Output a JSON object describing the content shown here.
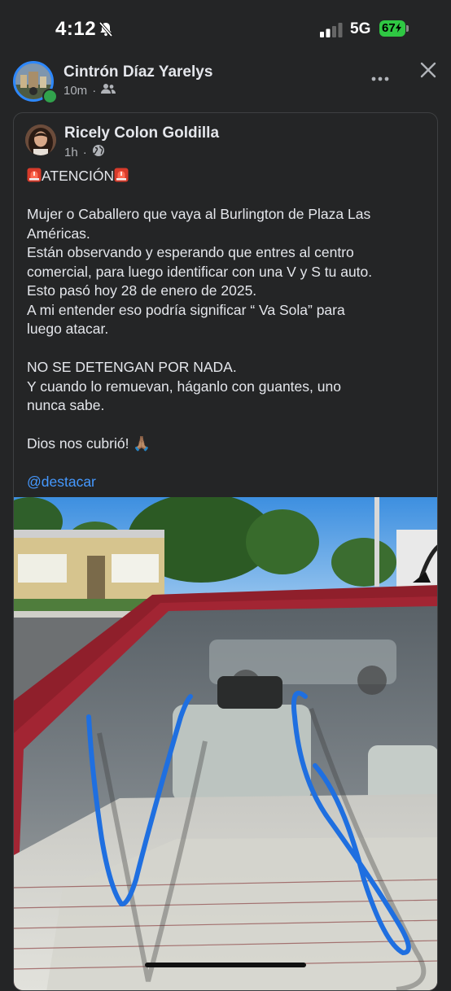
{
  "status_bar": {
    "time": "4:12",
    "network": "5G",
    "battery": "67"
  },
  "post": {
    "author": "Cintrón Díaz Yarelys",
    "time": "10m",
    "audience_icon": "friends-icon",
    "more_icon": "ellipsis-icon",
    "close_icon": "close-icon"
  },
  "shared_post": {
    "author": "Ricely Colon Goldilla",
    "time": "1h",
    "audience_icon": "globe-icon",
    "heading": "ATENCIÓN",
    "paragraph1": [
      "Mujer o Caballero que vaya al Burlington de Plaza Las",
      "Américas.",
      "Están observando y esperando que entres al centro",
      "comercial, para luego identificar con una V y S tu auto.",
      "Esto pasó hoy 28 de enero de 2025.",
      "A mi entender eso podría significar “ Va Sola” para",
      "luego atacar."
    ],
    "paragraph2": [
      "NO SE DETENGAN POR NADA.",
      "Y cuando lo remuevan, háganlo con guantes, uno",
      "nunca sabe."
    ],
    "closing": "Dios nos cubrió!",
    "closing_emoji": "🙏🏽",
    "hashtag": "@destacar"
  },
  "colors": {
    "background": "#242526",
    "text": "#e4e6eb",
    "secondary": "#b0b3b8",
    "link": "#4599ff",
    "battery": "#2fc743",
    "story_ring": "#2d88ff",
    "online": "#31a24c",
    "marker_blue": "#1f6fe0"
  }
}
